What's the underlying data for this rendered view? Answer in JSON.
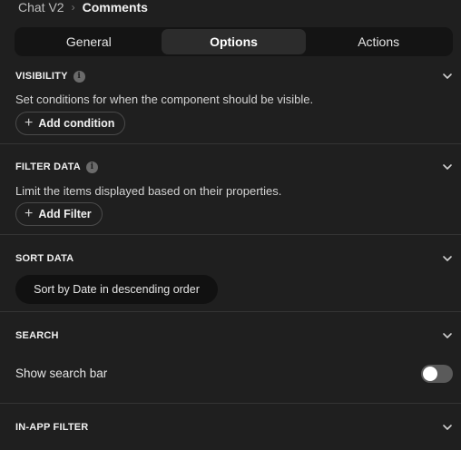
{
  "breadcrumb": {
    "parent": "Chat V2",
    "separator": "›",
    "current": "Comments"
  },
  "tabs": [
    {
      "label": "General",
      "active": false
    },
    {
      "label": "Options",
      "active": true
    },
    {
      "label": "Actions",
      "active": false
    }
  ],
  "sections": {
    "visibility": {
      "title": "VISIBILITY",
      "description": "Set conditions for when the component should be visible.",
      "button_label": "Add condition"
    },
    "filter_data": {
      "title": "FILTER DATA",
      "description": "Limit the items displayed based on their properties.",
      "button_label": "Add Filter"
    },
    "sort_data": {
      "title": "SORT DATA",
      "sort_value": "Sort by Date in descending order"
    },
    "search": {
      "title": "SEARCH",
      "toggle_label": "Show search bar",
      "toggle_on": false
    },
    "in_app_filter": {
      "title": "IN-APP FILTER"
    }
  },
  "icons": {
    "info": "info-icon",
    "expand": "chevron-down-icon",
    "add": "plus-icon"
  },
  "colors": {
    "background": "#1f1f1f",
    "tab_bar": "#141414",
    "active_tab": "#2c2c2c",
    "divider": "#343434"
  }
}
